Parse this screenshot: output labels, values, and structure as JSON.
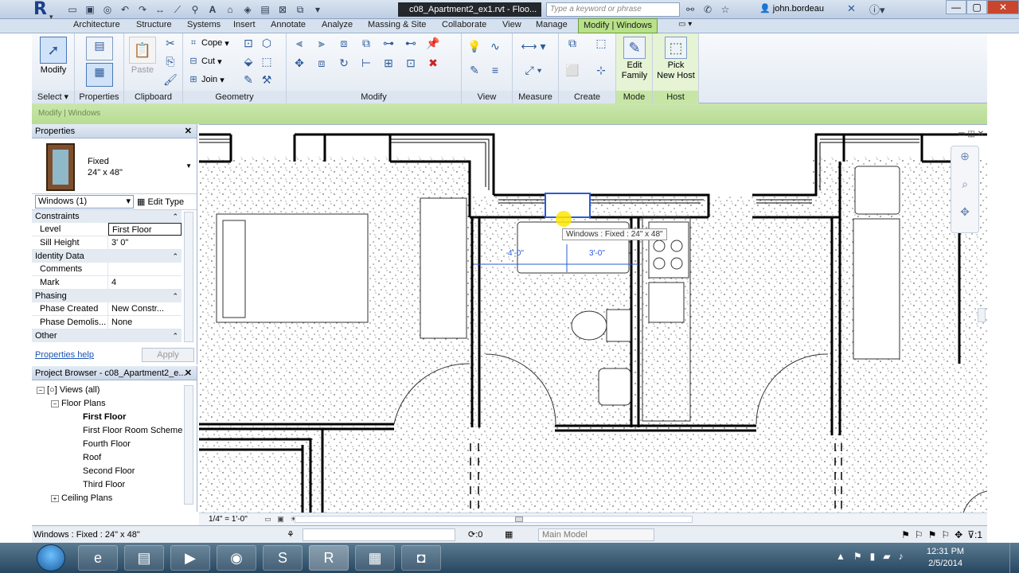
{
  "titlebar": {
    "app_logo": "R",
    "doc_title": "c08_Apartment2_ex1.rvt - Floo...",
    "search_placeholder": "Type a keyword or phrase",
    "user": "john.bordeau",
    "icons": [
      "binoculars-icon",
      "comm-center-icon",
      "star-icon",
      "user-icon",
      "x-icon",
      "help-icon"
    ]
  },
  "tabs": [
    "Architecture",
    "Structure",
    "Systems",
    "Insert",
    "Annotate",
    "Analyze",
    "Massing & Site",
    "Collaborate",
    "View",
    "Manage",
    "Modify | Windows"
  ],
  "ribbon": {
    "select": {
      "button": "Modify",
      "label": "Select"
    },
    "properties": {
      "label": "Properties"
    },
    "clipboard": {
      "paste": "Paste",
      "label": "Clipboard"
    },
    "geometry": {
      "cope": "Cope",
      "cut": "Cut",
      "join": "Join",
      "label": "Geometry"
    },
    "modify": {
      "label": "Modify"
    },
    "view": {
      "label": "View"
    },
    "measure": {
      "label": "Measure"
    },
    "create": {
      "label": "Create"
    },
    "mode": {
      "button_line1": "Edit",
      "button_line2": "Family",
      "label": "Mode"
    },
    "host": {
      "button_line1": "Pick",
      "button_line2": "New Host",
      "label": "Host"
    }
  },
  "context_bar": "Modify | Windows",
  "properties": {
    "title": "Properties",
    "type_family": "Fixed",
    "type_size": "24\" x 48\"",
    "instance_selector": "Windows (1)",
    "edit_type": "Edit Type",
    "categories": [
      {
        "name": "Constraints",
        "rows": [
          {
            "key": "Level",
            "value": "First Floor"
          },
          {
            "key": "Sill Height",
            "value": "3'  0\""
          }
        ]
      },
      {
        "name": "Identity Data",
        "rows": [
          {
            "key": "Comments",
            "value": ""
          },
          {
            "key": "Mark",
            "value": "4"
          }
        ]
      },
      {
        "name": "Phasing",
        "rows": [
          {
            "key": "Phase Created",
            "value": "New Constr..."
          },
          {
            "key": "Phase Demolis...",
            "value": "None"
          }
        ]
      },
      {
        "name": "Other",
        "rows": []
      }
    ],
    "help_link": "Properties help",
    "apply": "Apply"
  },
  "browser": {
    "title": "Project Browser - c08_Apartment2_e...",
    "items": [
      {
        "label": "Views (all)",
        "level": 0,
        "toggle": "−"
      },
      {
        "label": "Floor Plans",
        "level": 1,
        "toggle": "−"
      },
      {
        "label": "First Floor",
        "level": 2,
        "bold": true
      },
      {
        "label": "First Floor Room Scheme",
        "level": 2
      },
      {
        "label": "Fourth Floor",
        "level": 2
      },
      {
        "label": "Roof",
        "level": 2
      },
      {
        "label": "Second Floor",
        "level": 2
      },
      {
        "label": "Third Floor",
        "level": 2
      },
      {
        "label": "Ceiling Plans",
        "level": 1,
        "toggle": "+"
      }
    ]
  },
  "canvas": {
    "tooltip": "Windows : Fixed : 24\" x 48\"",
    "dim_left": "4'-0\"",
    "dim_right": "3'-0\""
  },
  "view_bar": {
    "scale": "1/4\" = 1'-0\""
  },
  "status": {
    "left": "Windows : Fixed : 24\" x 48\"",
    "zero": ":0",
    "model": "Main Model"
  },
  "taskbar": {
    "apps": [
      "ie-icon",
      "explorer-icon",
      "media-icon",
      "chrome-icon",
      "skype-icon",
      "revit-icon",
      "files-icon",
      "camera-icon"
    ],
    "time": "12:31 PM",
    "date": "2/5/2014"
  }
}
